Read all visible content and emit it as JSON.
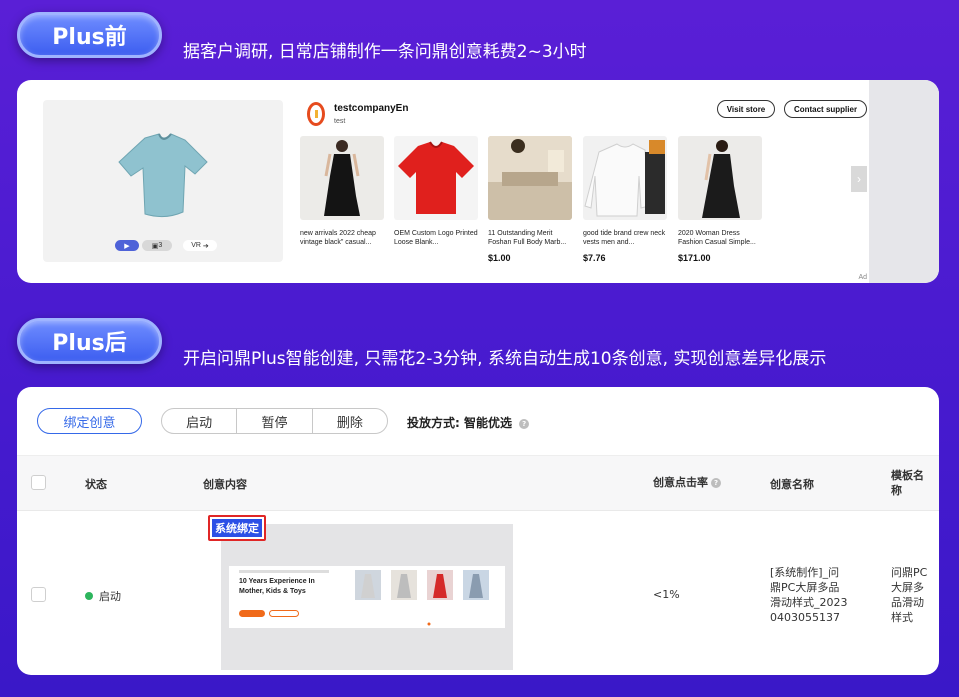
{
  "before": {
    "badge": "Plus前",
    "headline": "据客户调研, 日常店铺制作一条问鼎创意耗费2~3小时"
  },
  "store": {
    "company_name": "testcompanyEn",
    "company_sub": "test",
    "visit_store": "Visit store",
    "contact_supplier": "Contact supplier",
    "media_image_count": "3",
    "media_vr": "VR",
    "ad_label": "Ad",
    "products": [
      {
        "title": "new arrivals 2022 cheap vintage black\" casual...",
        "price": ""
      },
      {
        "title": "OEM Custom Logo Printed Loose Blank...",
        "price": ""
      },
      {
        "title": "11 Outstanding Merit Foshan Full Body Marb...",
        "price": "$1.00"
      },
      {
        "title": "good tide brand crew neck vests men and...",
        "price": "$7.76"
      },
      {
        "title": "2020 Woman Dress Fashion Casual Simple...",
        "price": "$171.00"
      }
    ],
    "colors": {
      "accent": "#4e62d8",
      "logo": "#e64b1e"
    }
  },
  "after": {
    "badge": "Plus后",
    "headline": "开启问鼎Plus智能创建, 只需花2-3分钟, 系统自动生成10条创意, 实现创意差异化展示"
  },
  "manager": {
    "tab_bind": "绑定创意",
    "btn_start": "启动",
    "btn_pause": "暂停",
    "btn_delete": "删除",
    "delivery_label": "投放方式:",
    "delivery_value": "智能优选",
    "columns": {
      "status": "状态",
      "content": "创意内容",
      "ctr": "创意点击率",
      "name": "创意名称",
      "template_line1": "模板名",
      "template_line2": "称"
    },
    "row": {
      "status": "启动",
      "tag": "系统绑定",
      "preview_headline_1": "10 Years Experience In",
      "preview_headline_2": "Mother, Kids & Toys",
      "ctr": "<1%",
      "name_lines": [
        "[系统制作]_问",
        "鼎PC大屏多品",
        "滑动样式_2023",
        "0403055137"
      ],
      "template_lines": [
        "问鼎PC",
        "大屏多",
        "品滑动",
        "样式"
      ]
    },
    "colors": {
      "primary": "#3569e8",
      "status_active": "#2db55d",
      "tag_border": "#e02626"
    }
  }
}
